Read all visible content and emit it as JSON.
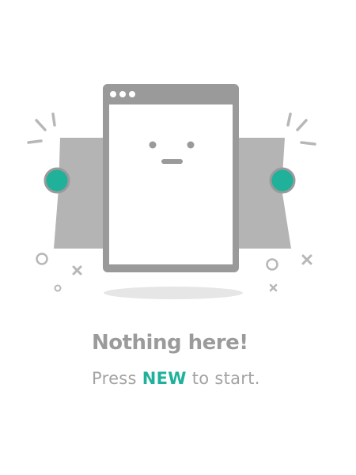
{
  "empty_state": {
    "title": "Nothing here!",
    "hint_prefix": "Press ",
    "hint_action": "NEW",
    "hint_suffix": " to start."
  },
  "colors": {
    "accent": "#1fb19a",
    "text_gray": "#9b9b9b",
    "illustration_gray": "#9a9a9a",
    "banner_gray": "#b4b4b4",
    "shadow_gray": "#e6e6e6"
  },
  "icons": {
    "window": "empty-window-icon",
    "face": "neutral-face-icon"
  }
}
